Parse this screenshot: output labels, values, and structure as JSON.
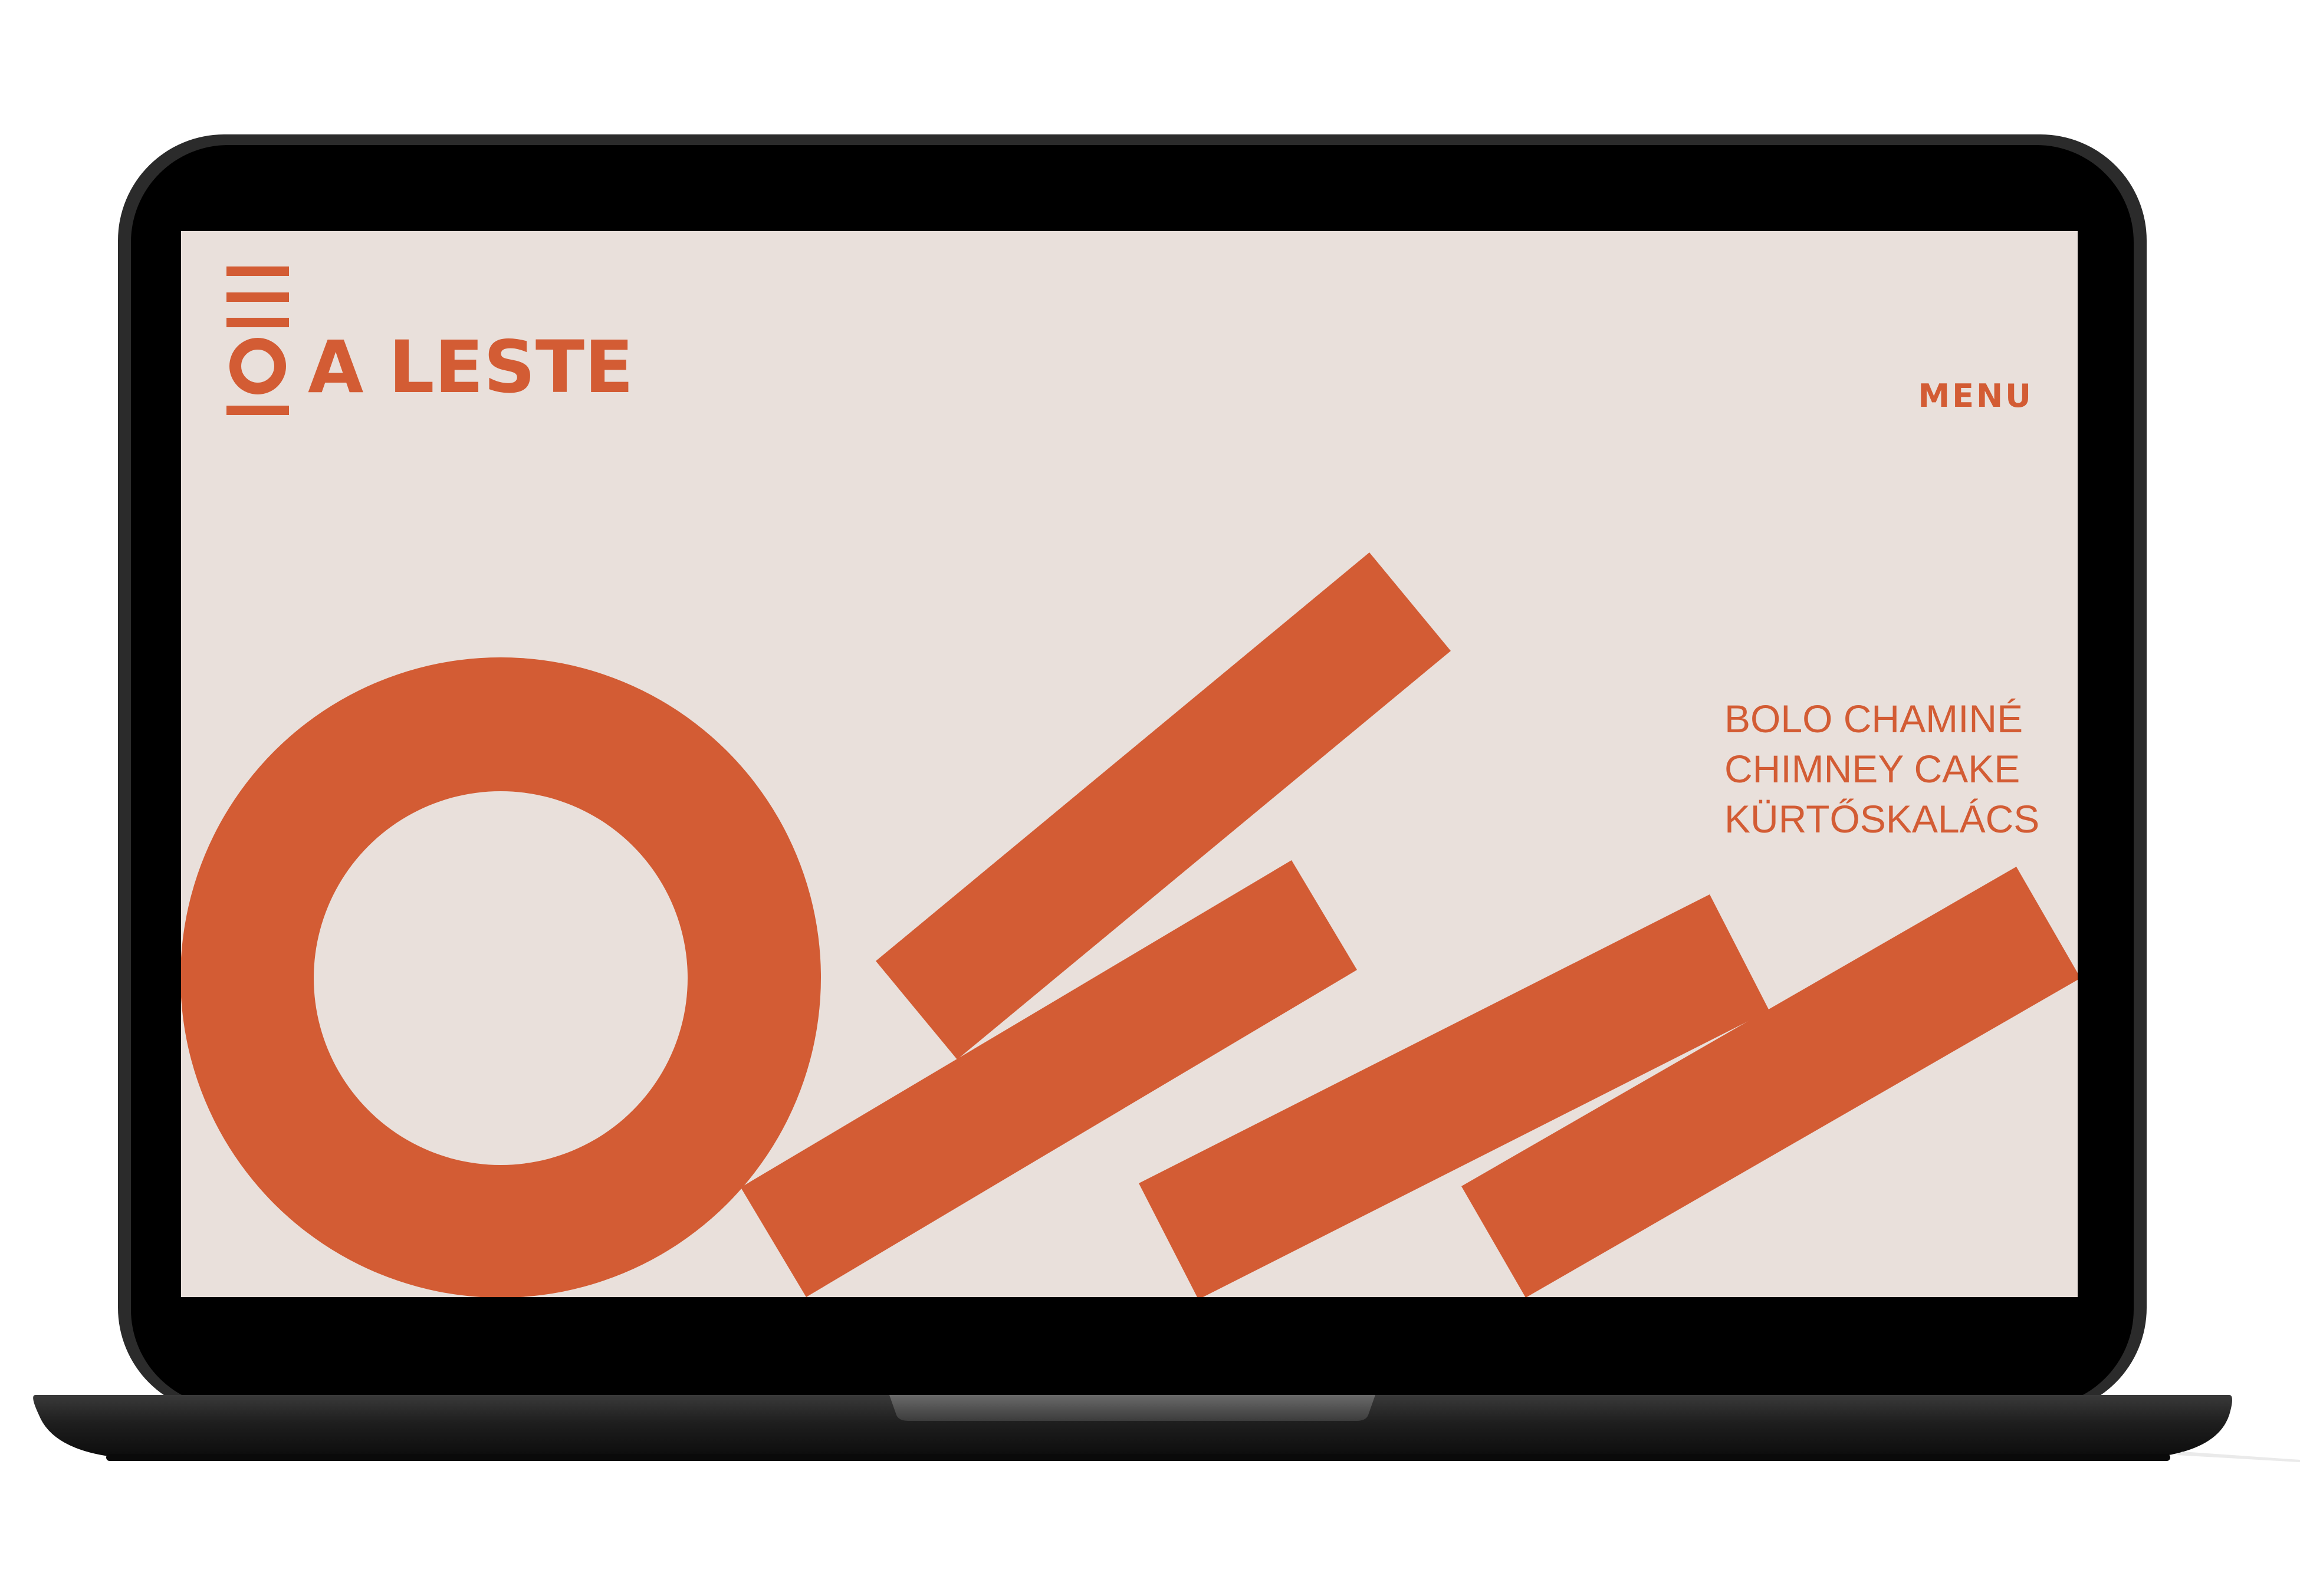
{
  "site": {
    "brand_name": "A LESTE",
    "nav": {
      "menu_label": "MENU"
    },
    "tagline": [
      "BOLO CHAMINÉ",
      "CHIMNEY CAKE",
      "KÜRTŐSKALÁCS"
    ]
  },
  "colors": {
    "accent": "#D35C34",
    "page_background": "#E9E0DB",
    "bezel": "#000000",
    "laptop_base": "#2A2A2A",
    "surround": "#FFFFFF"
  },
  "icons": {
    "logo": "a-leste-logo-icon"
  }
}
